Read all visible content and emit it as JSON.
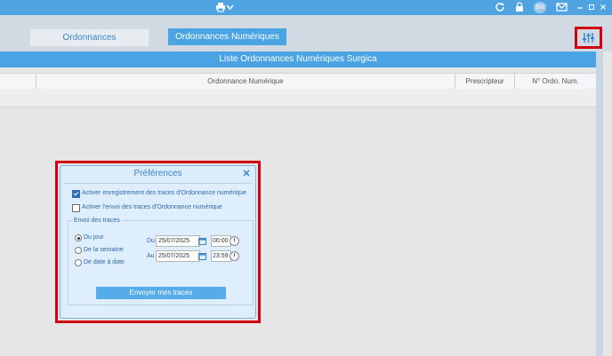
{
  "titlebar": {
    "user_badge": "BN",
    "icons": [
      "printer-icon",
      "chevron-down-icon",
      "refresh-icon",
      "lock-icon",
      "mail-icon",
      "minimize-icon",
      "maximize-icon",
      "close-icon"
    ]
  },
  "tabs": [
    {
      "label": "Ordonnances"
    },
    {
      "label": "Ordonnances Numériques"
    }
  ],
  "list": {
    "title": "Liste Ordonnances Numériques Surgica",
    "columns": [
      "Ordonnance Numérique",
      "Prescripteur",
      "N° Ordo. Num."
    ]
  },
  "dialog": {
    "title": "Préférences",
    "close": "✕",
    "options": [
      {
        "label": "Activer enregistrement des traces d'Ordonnance numérique",
        "checked": true
      },
      {
        "label": "Activer l'envoi des traces d'Ordonnance numérique",
        "checked": false
      }
    ],
    "group": {
      "legend": "Envoi des traces",
      "periods": [
        {
          "label": "Du jour",
          "selected": true
        },
        {
          "label": "De la semaine",
          "selected": false
        },
        {
          "label": "De date à date",
          "selected": false
        }
      ],
      "from": {
        "label": "Du",
        "date": "25/07/2025",
        "time": "00:00"
      },
      "to": {
        "label": "Au",
        "date": "25/07/2025",
        "time": "23:59"
      }
    },
    "submit": "Envoyer mes traces"
  },
  "colors": {
    "accent": "#4aa3e2",
    "titlebar": "#4ea3e0",
    "highlight_border": "#d10010"
  }
}
